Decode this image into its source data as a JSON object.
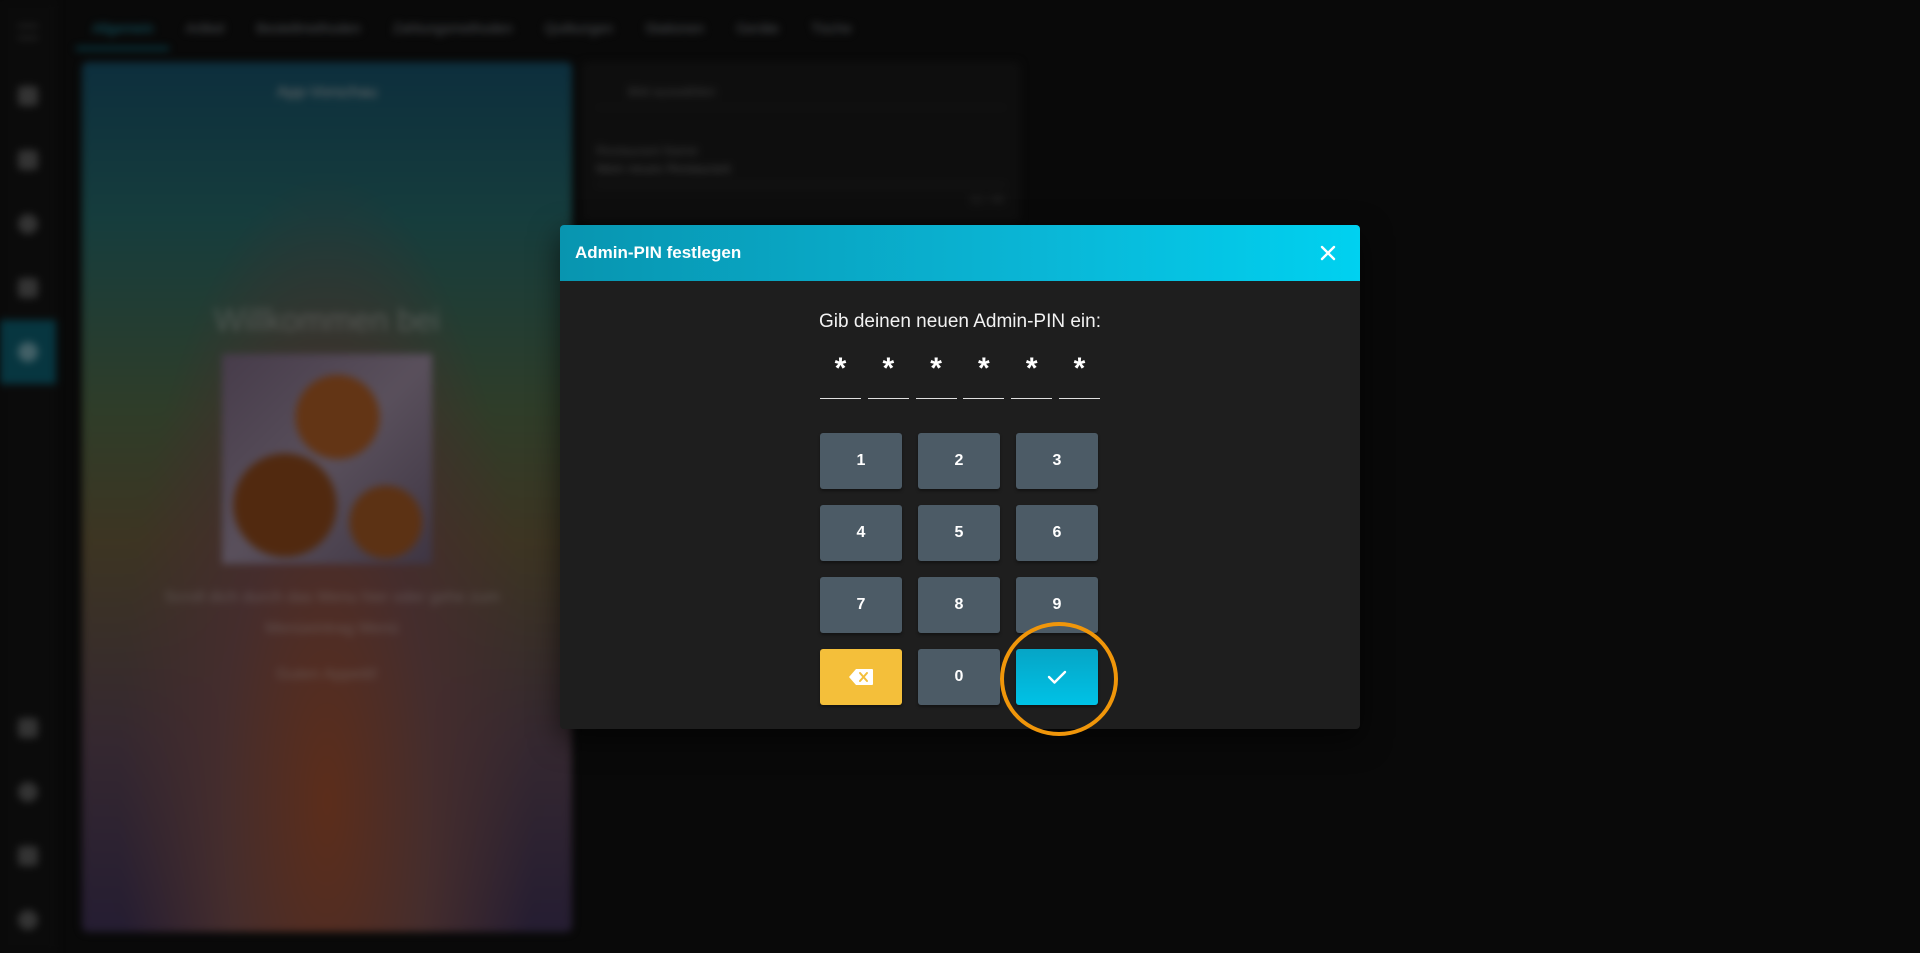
{
  "background": {
    "nav_rail": {
      "items": [
        "menu-icon",
        "home-icon",
        "store-icon",
        "globe-icon",
        "chat-icon",
        "settings-icon",
        "gift-icon",
        "help-icon",
        "chart-icon",
        "account-icon"
      ]
    },
    "tabs": [
      {
        "label": "Allgemein",
        "active": true
      },
      {
        "label": "Artikel"
      },
      {
        "label": "Bestellmethoden"
      },
      {
        "label": "Zahlungsmethoden"
      },
      {
        "label": "Quittungen"
      },
      {
        "label": "Stationen"
      },
      {
        "label": "Geräte"
      },
      {
        "label": "Tische"
      }
    ],
    "preview": {
      "title": "App-Vorschau",
      "welcome": "Willkommen bei",
      "text": "Scroll dich durch das Menu hier oder gehe zum Menüeintrag Menü",
      "footer": "Guten Appetit!"
    },
    "settings": {
      "image_button": "Bild auswählen",
      "restaurant_name_label": "Restaurant Name",
      "restaurant_name_value": "Mein neues Restaurant",
      "char_count": "21 / 40"
    }
  },
  "dialog": {
    "title": "Admin-PIN festlegen",
    "prompt": "Gib deinen neuen Admin-PIN ein:",
    "pin_digits": [
      "*",
      "*",
      "*",
      "*",
      "*",
      "*"
    ],
    "keys": [
      "1",
      "2",
      "3",
      "4",
      "5",
      "6",
      "7",
      "8",
      "9"
    ],
    "zero_key": "0",
    "colors": {
      "header_start": "#0895b0",
      "header_end": "#00d1f0",
      "key_bg": "#4c5b66",
      "backspace_bg": "#f4bf3a",
      "confirm_bg": "#00c2e6",
      "highlight_ring": "#f0960a"
    },
    "icons": {
      "close": "close-icon",
      "backspace": "backspace-icon",
      "confirm": "checkmark-icon"
    }
  }
}
